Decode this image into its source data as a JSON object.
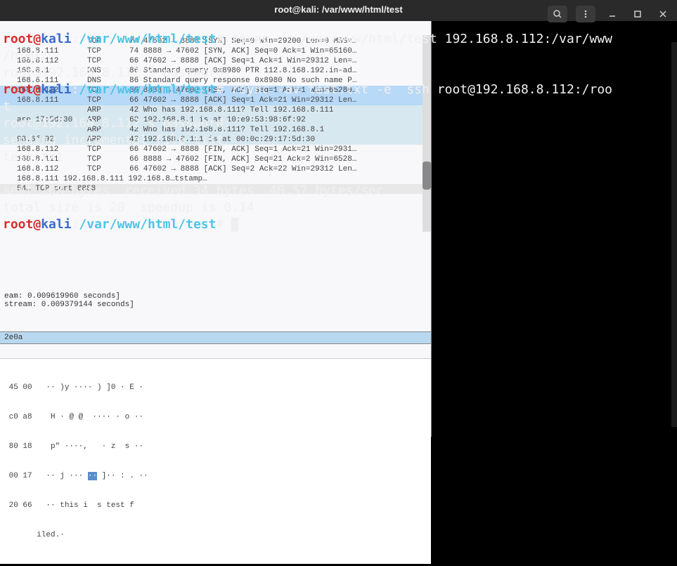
{
  "titlebar": {
    "title": "root@kali: /var/www/html/test"
  },
  "prompt": {
    "user": "root",
    "at": "@",
    "host": "kali",
    "colon": ":",
    "path": "/var/www/html/test",
    "hash": "# "
  },
  "lines": {
    "cmd1": "rsync -r /var/www/html/test 192.168.8.112:/var/www/html/",
    "cmd1_a": "rsync -r /var/www/html/test 192.168.8.112:/var/www",
    "cmd1_b": "/html/",
    "pw1": "root@192.168.8.112's password: ",
    "cmd2": "rsync -av test.txt -e  ssh root@192.168.8.112:/roo",
    "cmd2_b": "t",
    "pw2": "root@192.168.8.112's password: ",
    "sending": "sending incremental file list",
    "file": "test.txt",
    "blank": "",
    "sent": "sent 108 bytes  received 34 bytes  40.57 bytes/sec",
    "total": "total size is 20  speedup is 0.14"
  },
  "wireshark": {
    "rows": [
      {
        "ip": "",
        "proto": "TCP",
        "info": "74 47602 → 8888 [SYN] Seq=0 Win=29200 Len=0 MSS=…",
        "cls": ""
      },
      {
        "ip": "168.8.111",
        "proto": "TCP",
        "info": "74 8888 → 47602 [SYN, ACK] Seq=0 Ack=1 Win=65160…",
        "cls": ""
      },
      {
        "ip": "168.8.112",
        "proto": "TCP",
        "info": "66 47602 → 8888 [ACK] Seq=1 Ack=1 Win=29312 Len=…",
        "cls": ""
      },
      {
        "ip": "168.8.1",
        "proto": "DNS",
        "info": "86 Standard query 0x8980 PTR 112.8.168.192.in-ad…",
        "cls": ""
      },
      {
        "ip": "168.8.111",
        "proto": "DNS",
        "info": "86 Standard query response 0x8980 No such name P…",
        "cls": ""
      },
      {
        "ip": "168.8.112",
        "proto": "TCP",
        "info": "86 8888 → 47602 [PSH, ACK] Seq=1 Ack=1 Win=65280…",
        "cls": "highlight"
      },
      {
        "ip": "168.8.111",
        "proto": "TCP",
        "info": "66 47602 → 8888 [ACK] Seq=1 Ack=21 Win=29312 Len…",
        "cls": "highlight"
      },
      {
        "ip": "",
        "proto": "ARP",
        "info": "42 Who has 192.168.8.111? Tell 192.168.8.111",
        "cls": "arp"
      },
      {
        "ip": "are 17:5d:30",
        "proto": "ARP",
        "info": "60 192.168.8.1 is at 10:e9:53:98:6f:92",
        "cls": "arp"
      },
      {
        "ip": "",
        "proto": "ARP",
        "info": "42 Who has 192.168.8.111? Tell 192.168.8.1",
        "cls": "arp"
      },
      {
        "ip": "98:6f:92",
        "proto": "ARP",
        "info": "42 192.168.8.111 is at 00:0c:29:17:5d:30",
        "cls": "arp"
      },
      {
        "ip": "168.8.112",
        "proto": "TCP",
        "info": "66 47602 → 8888 [FIN, ACK] Seq=1 Ack=21 Win=2931…",
        "cls": ""
      },
      {
        "ip": "168.8.111",
        "proto": "TCP",
        "info": "66 8888 → 47602 [FIN, ACK] Seq=21 Ack=2 Win=6528…",
        "cls": ""
      },
      {
        "ip": "168.8.112",
        "proto": "TCP",
        "info": "66 47602 → 8888 [ACK] Seq=2 Ack=22 Win=29312 Len…",
        "cls": ""
      }
    ],
    "tree_tstamp": "168.8.111 192.168.8.111 192.168.8…tstamp…",
    "tree_tcp": "54… TCP port 8888",
    "stream1": "eam: 0.009619960 seconds]",
    "stream2": "stream: 0.009379144 seconds]",
    "hex_hdr": "2e0a",
    "hex1": " 45 00   ·· )y ···· ) ]0 · E ·",
    "hex2": " c0 a8    H · @ @  ···· · o ··",
    "hex3": " 80 18    p\" ····,   · z  s ··",
    "hex4": " 00 17   ·· j ··· ·· ]·· : . ··",
    "hex5": " 20 66   ·· this i  s test f",
    "hex6": "       iled.·"
  }
}
